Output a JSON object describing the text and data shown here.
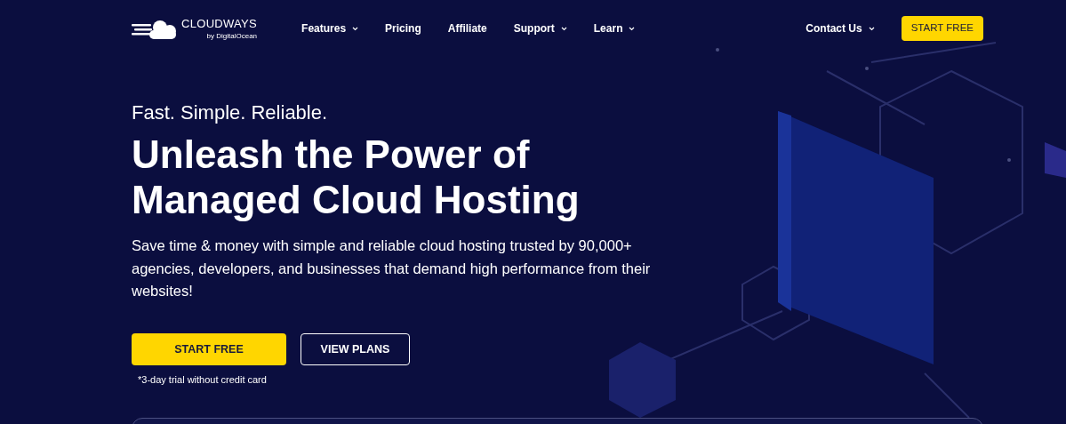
{
  "logo": {
    "name": "CLOUDWAYS",
    "tagline": "by DigitalOcean"
  },
  "nav": [
    {
      "label": "Features",
      "has_menu": true
    },
    {
      "label": "Pricing",
      "has_menu": false
    },
    {
      "label": "Affiliate",
      "has_menu": false
    },
    {
      "label": "Support",
      "has_menu": true
    },
    {
      "label": "Learn",
      "has_menu": true
    }
  ],
  "contact": {
    "label": "Contact Us",
    "has_menu": true
  },
  "header_cta": "START FREE",
  "hero": {
    "eyebrow": "Fast. Simple. Reliable.",
    "title": "Unleash the Power of Managed Cloud Hosting",
    "description": "Save time & money with simple and reliable cloud hosting trusted by 90,000+ agencies, developers, and businesses that demand high performance from their websites!",
    "primary_button": "START FREE",
    "secondary_button": "VIEW PLANS",
    "note": "*3-day trial without credit card"
  }
}
